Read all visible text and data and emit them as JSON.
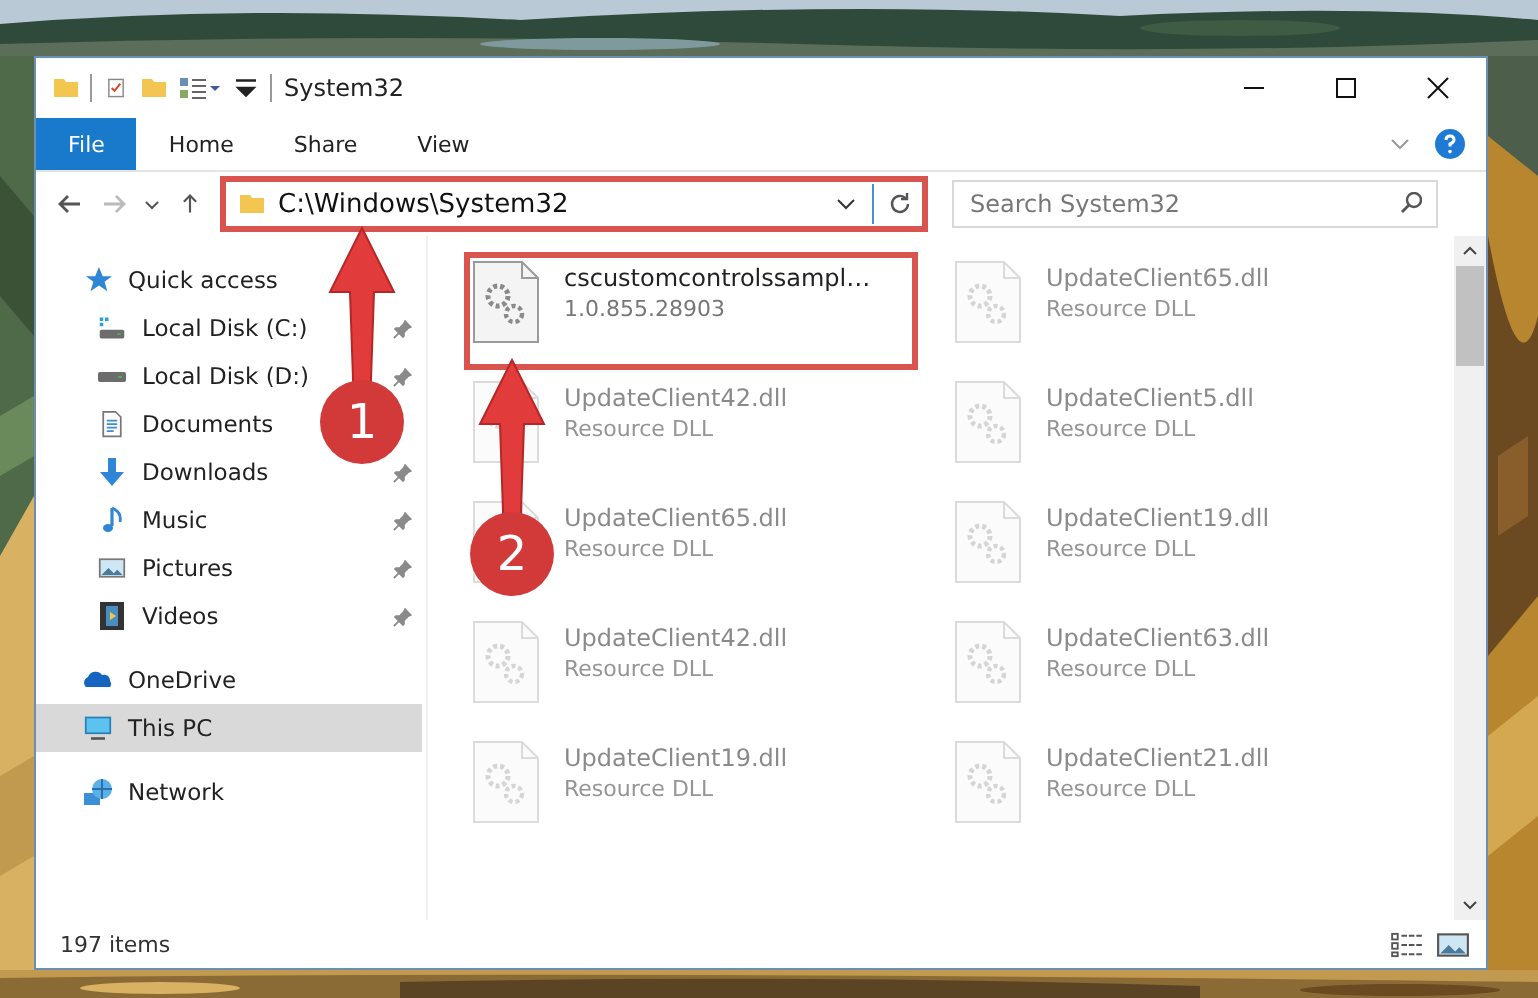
{
  "window": {
    "title": "System32"
  },
  "ribbon_tabs": [
    {
      "label": "File",
      "selected": true
    },
    {
      "label": "Home",
      "selected": false
    },
    {
      "label": "Share",
      "selected": false
    },
    {
      "label": "View",
      "selected": false
    }
  ],
  "address_bar": {
    "path": "C:\\Windows\\System32",
    "highlighted": true
  },
  "search": {
    "placeholder": "Search System32"
  },
  "nav": [
    {
      "label": "Quick access",
      "kind": "quick",
      "selected": false,
      "children": [
        {
          "label": "Local Disk (C:)",
          "kind": "drive-c",
          "pinned": true
        },
        {
          "label": "Local Disk (D:)",
          "kind": "drive",
          "pinned": true
        },
        {
          "label": "Documents",
          "kind": "documents",
          "pinned": false
        },
        {
          "label": "Downloads",
          "kind": "downloads",
          "pinned": true
        },
        {
          "label": "Music",
          "kind": "music",
          "pinned": true
        },
        {
          "label": "Pictures",
          "kind": "pictures",
          "pinned": true
        },
        {
          "label": "Videos",
          "kind": "videos",
          "pinned": true
        }
      ]
    },
    {
      "label": "OneDrive",
      "kind": "onedrive",
      "selected": false
    },
    {
      "label": "This PC",
      "kind": "pc",
      "selected": true
    },
    {
      "label": "Network",
      "kind": "network",
      "selected": false
    }
  ],
  "files": [
    {
      "name": "cscustomcontrolssampl…",
      "detail": "1.0.855.28903",
      "highlighted": true,
      "faded": false
    },
    {
      "name": "UpdateClient65.dll",
      "detail": "Resource DLL",
      "highlighted": false,
      "faded": true
    },
    {
      "name": "UpdateClient42.dll",
      "detail": "Resource DLL",
      "highlighted": false,
      "faded": true
    },
    {
      "name": "UpdateClient5.dll",
      "detail": "Resource DLL",
      "highlighted": false,
      "faded": true
    },
    {
      "name": "UpdateClient65.dll",
      "detail": "Resource DLL",
      "highlighted": false,
      "faded": true
    },
    {
      "name": "UpdateClient19.dll",
      "detail": "Resource DLL",
      "highlighted": false,
      "faded": true
    },
    {
      "name": "UpdateClient42.dll",
      "detail": "Resource DLL",
      "highlighted": false,
      "faded": true
    },
    {
      "name": "UpdateClient63.dll",
      "detail": "Resource DLL",
      "highlighted": false,
      "faded": true
    },
    {
      "name": "UpdateClient19.dll",
      "detail": "Resource DLL",
      "highlighted": false,
      "faded": true
    },
    {
      "name": "UpdateClient21.dll",
      "detail": "Resource DLL",
      "highlighted": false,
      "faded": true
    }
  ],
  "annotations": [
    {
      "label": "1"
    },
    {
      "label": "2"
    }
  ],
  "status_bar": {
    "count": "197 items"
  }
}
